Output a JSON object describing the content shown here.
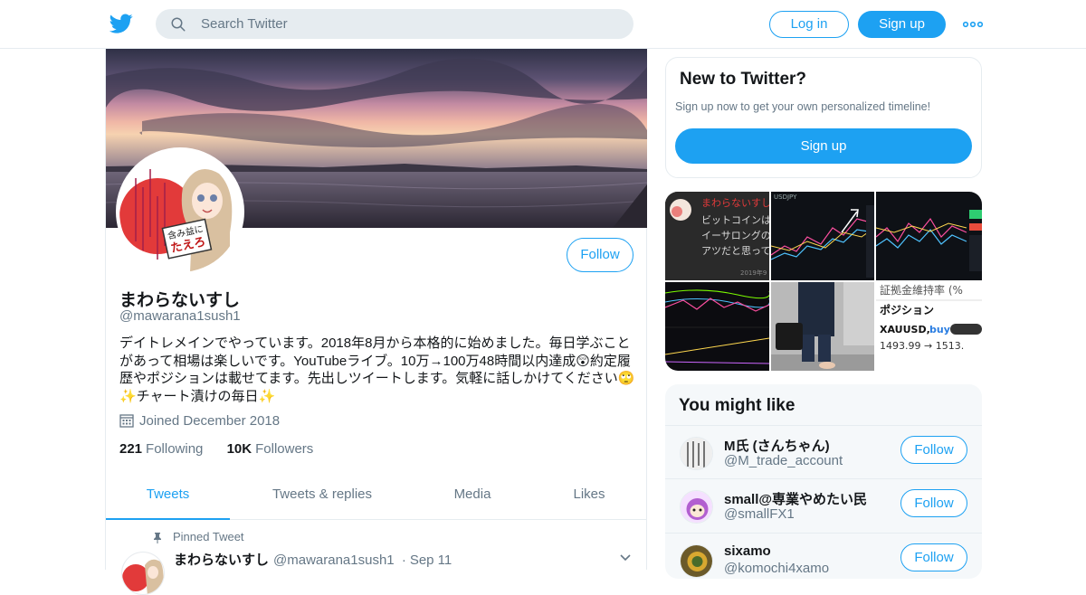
{
  "topbar": {
    "search_placeholder": "Search Twitter",
    "login_label": "Log in",
    "signup_label": "Sign up",
    "more_icon": "more-dots-icon"
  },
  "profile": {
    "name": "まわらないすし",
    "handle": "@mawarana1sush1",
    "follow_label": "Follow",
    "avatar_text_1": "含み益に",
    "avatar_text_2": "たえろ",
    "bio": "デイトレメインでやっています。2018年8月から本格的に始めました。毎日学ぶことがあって相場は楽しいです。YouTubeライブ。10万→100万48時間以内達成😲約定履歴やポジションは載せてます。先出しツイートします。気軽に話しかけてください🙄✨チャート漬けの毎日✨",
    "joined": "Joined December 2018",
    "following_count": "221",
    "following_label": "Following",
    "followers_count": "10K",
    "followers_label": "Followers"
  },
  "tabs": [
    {
      "label": "Tweets",
      "active": true
    },
    {
      "label": "Tweets & replies",
      "active": false
    },
    {
      "label": "Media",
      "active": false
    },
    {
      "label": "Likes",
      "active": false
    }
  ],
  "pinned_tweet": {
    "pinned_label": "Pinned Tweet",
    "name": "まわらないすし",
    "handle": "@mawarana1sush1",
    "separator": "·",
    "date": "Sep 11"
  },
  "new_to_twitter": {
    "title": "New to Twitter?",
    "subtitle": "Sign up now to get your own personalized timeline!",
    "signup_label": "Sign up"
  },
  "media_tiles": {
    "tile1_lines": [
      "まわらないすし",
      "ビットコインは",
      "イーサロングの",
      "アツだと思って"
    ],
    "tile1_date": "2019年9",
    "tile2_label": "USDJPY",
    "tile6_line1": "証拠金維持率 (%",
    "tile6_line2": "ポジション",
    "tile6_line3": "XAUUSD,",
    "tile6_buy": "buy",
    "tile6_line4": "1493.99 → 1513."
  },
  "you_might_like": {
    "title": "You might like",
    "follow_label": "Follow",
    "users": [
      {
        "name": "M氏 (さんちゃん)",
        "handle": "@M_trade_account"
      },
      {
        "name": "small@専業やめたい民",
        "handle": "@smallFX1"
      },
      {
        "name": "sixamo",
        "handle": "@komochi4xamo"
      }
    ]
  },
  "colors": {
    "accent": "#1da1f2",
    "text": "#14171a",
    "muted": "#657786",
    "border": "#e6ecf0"
  }
}
